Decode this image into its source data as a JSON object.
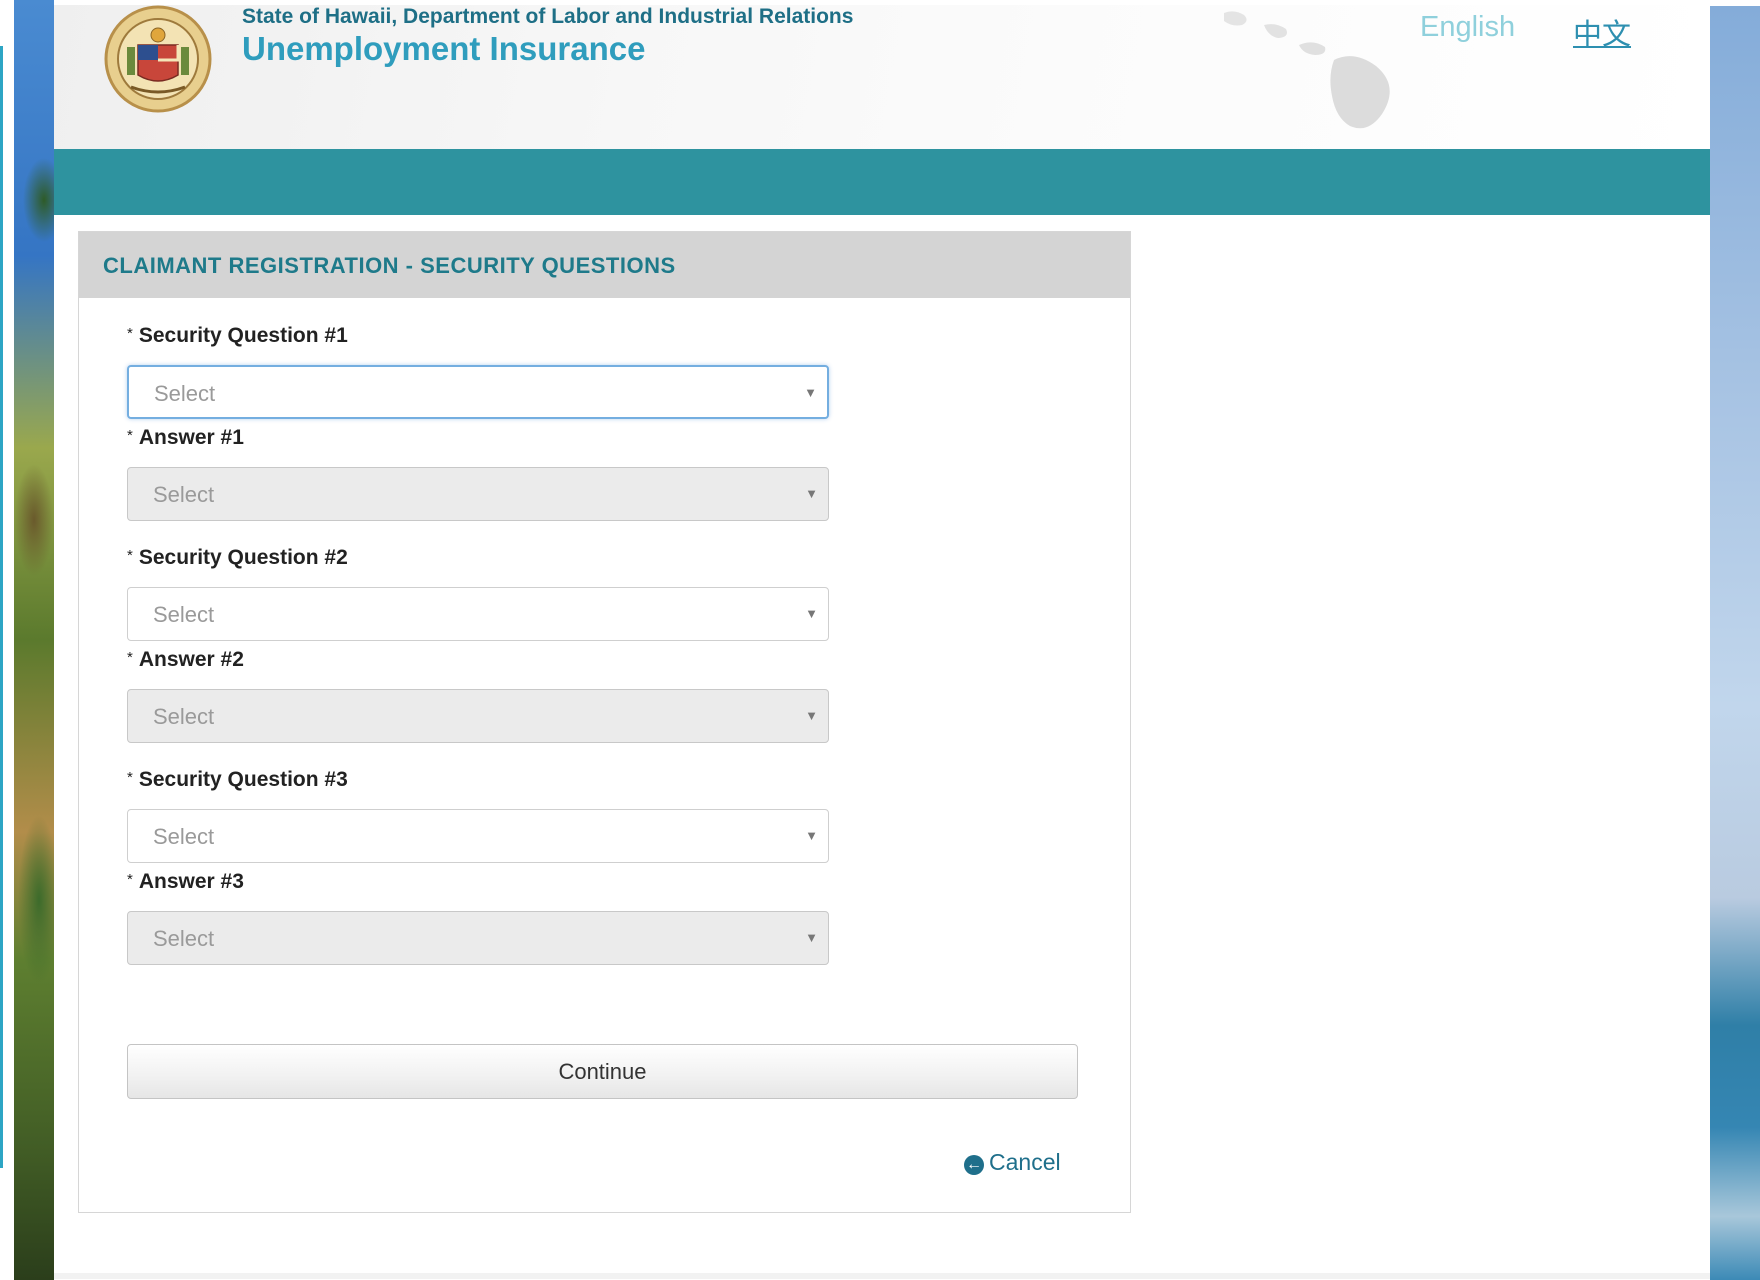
{
  "header": {
    "agency": "State of Hawaii, Department of Labor and Industrial Relations",
    "product": "Unemployment Insurance",
    "languages": {
      "english": "English",
      "chinese": "中文"
    },
    "seal_text": "STATE OF HAWAII"
  },
  "panel": {
    "title": "CLAIMANT REGISTRATION - SECURITY QUESTIONS",
    "required_marker": "*",
    "fields": [
      {
        "label": "Security Question #1",
        "value": "Select",
        "state": "focused"
      },
      {
        "label": "Answer #1",
        "value": "Select",
        "state": "disabled"
      },
      {
        "label": "Security Question #2",
        "value": "Select",
        "state": "enabled"
      },
      {
        "label": "Answer #2",
        "value": "Select",
        "state": "disabled"
      },
      {
        "label": "Security Question #3",
        "value": "Select",
        "state": "enabled"
      },
      {
        "label": "Answer #3",
        "value": "Select",
        "state": "disabled"
      }
    ],
    "continue_label": "Continue",
    "cancel_label": "Cancel",
    "cancel_icon": "arrow-circle-left-icon"
  },
  "colors": {
    "teal_bar": "#2e939f",
    "title_teal": "#1e7a8a",
    "link_blue": "#1f6f8b",
    "product_blue": "#2f9dbd"
  }
}
